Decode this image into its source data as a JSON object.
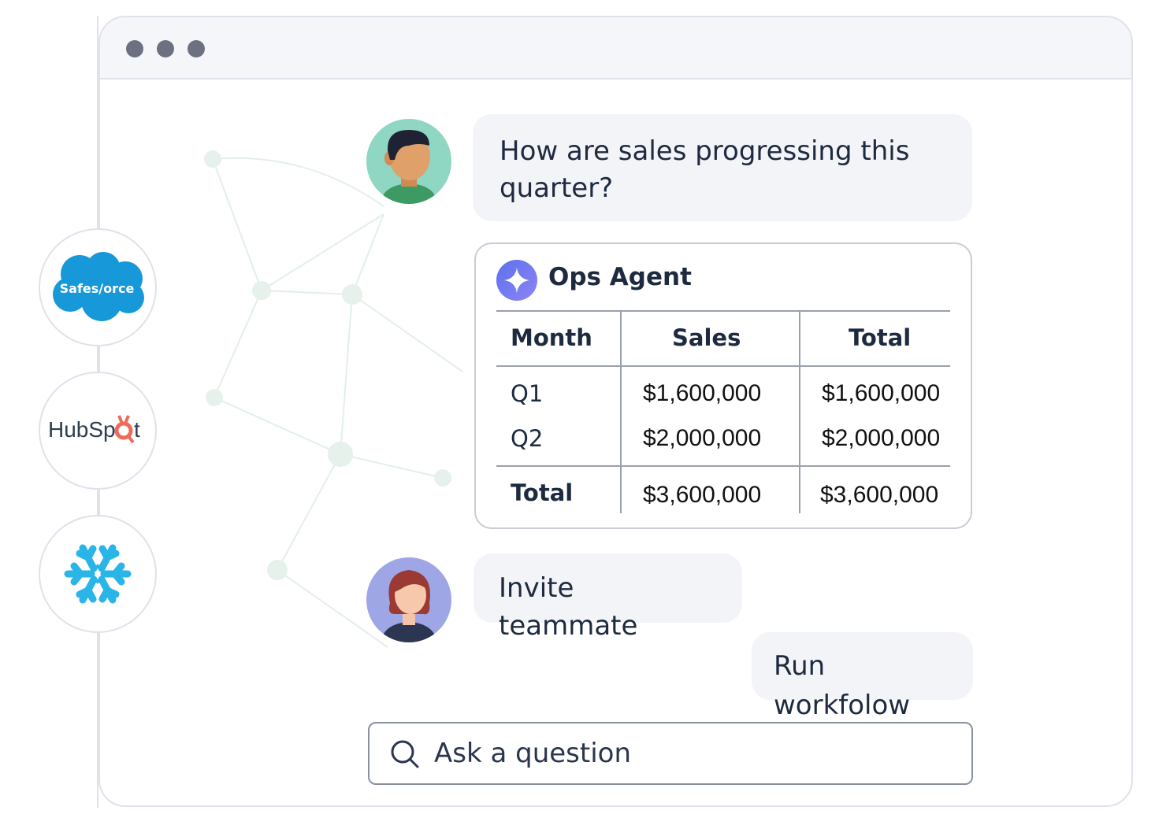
{
  "window": {
    "controls": [
      "window-dot",
      "window-dot",
      "window-dot"
    ]
  },
  "integrations": [
    {
      "name": "Salesforce",
      "label": "Safes/orce",
      "icon": "salesforce-cloud-icon",
      "color": "#1798d8"
    },
    {
      "name": "HubSpot",
      "label_part1": "HubSp",
      "label_part2": "t",
      "icon": "hubspot-sprocket-icon",
      "color": "#f06a5a"
    },
    {
      "name": "Snowflake",
      "icon": "snowflake-icon",
      "color": "#29b5e8"
    }
  ],
  "chat": {
    "user_question": "How are sales progressing this quarter?",
    "agent": {
      "name": "Ops Agent",
      "icon": "sparkle-icon",
      "table": {
        "headers": [
          "Month",
          "Sales",
          "Total"
        ],
        "rows": [
          [
            "Q1",
            "$1,600,000",
            "$1,600,000"
          ],
          [
            "Q2",
            "$2,000,000",
            "$2,000,000"
          ]
        ],
        "footer": [
          "Total",
          "$3,600,000",
          "$3,600,000"
        ]
      }
    },
    "invite_label": "Invite teammate",
    "run_label": "Run workfolow"
  },
  "search": {
    "placeholder": "Ask a question",
    "icon": "search-icon"
  },
  "colors": {
    "border": "#dfe2ea",
    "bubble": "#f3f4f8",
    "accent": "#6b78ef",
    "text": "#1d2a3f"
  }
}
